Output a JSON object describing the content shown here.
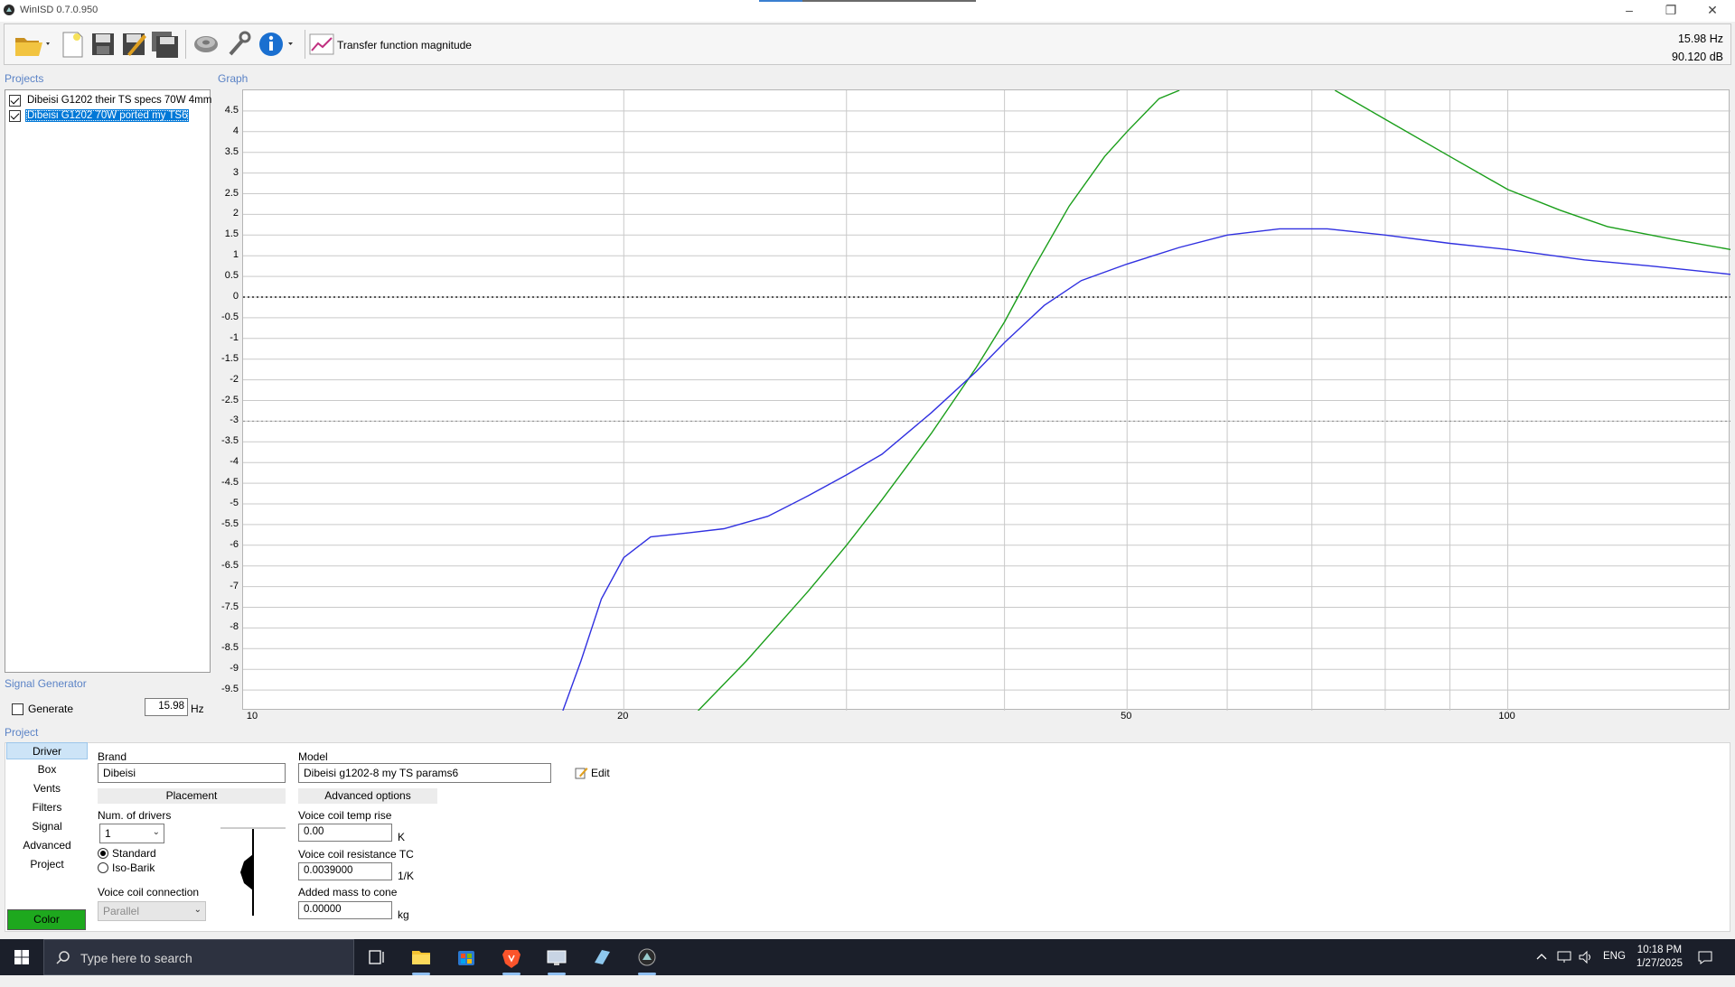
{
  "window": {
    "title": "WinISD 0.7.0.950"
  },
  "toolbar": {
    "mode_label": "Transfer function magnitude",
    "readout_freq": "15.98 Hz",
    "readout_db": "90.120 dB"
  },
  "sections": {
    "projects": "Projects",
    "graph": "Graph",
    "signal_generator": "Signal Generator",
    "project": "Project"
  },
  "projects": [
    {
      "label": "Dibeisi G1202 their TS specs 70W 4mm",
      "checked": true,
      "selected": false
    },
    {
      "label": "Dibeisi G1202 70W ported my TS6",
      "checked": true,
      "selected": true
    }
  ],
  "signal_generator": {
    "generate_label": "Generate",
    "frequency": "15.98",
    "unit": "Hz"
  },
  "nav": [
    "Driver",
    "Box",
    "Vents",
    "Filters",
    "Signal",
    "Advanced",
    "Project"
  ],
  "color_button": "Color",
  "driver": {
    "brand_label": "Brand",
    "brand_value": "Dibeisi",
    "model_label": "Model",
    "model_value": "Dibeisi g1202-8 my TS params6",
    "edit_label": "Edit",
    "placement_header": "Placement",
    "advanced_header": "Advanced options",
    "num_drivers_label": "Num. of drivers",
    "num_drivers_value": "1",
    "standard_label": "Standard",
    "isobarik_label": "Iso-Barik",
    "vc_connection_label": "Voice coil connection",
    "vc_connection_value": "Parallel",
    "vc_temp_label": "Voice coil temp rise",
    "vc_temp_value": "0.00",
    "vc_temp_unit": "K",
    "vc_res_label": "Voice coil resistance TC",
    "vc_res_value": "0.0039000",
    "vc_res_unit": "1/K",
    "mass_label": "Added mass to cone",
    "mass_value": "0.00000",
    "mass_unit": "kg"
  },
  "taskbar": {
    "search_placeholder": "Type here to search",
    "lang": "ENG",
    "time": "10:18 PM",
    "date": "1/27/2025"
  },
  "chart_data": {
    "type": "line",
    "title": "",
    "xlabel": "",
    "ylabel": "",
    "x_scale": "log",
    "xlim": [
      10,
      150
    ],
    "ylim": [
      -10,
      5
    ],
    "x_ticks": [
      "10",
      "20",
      "50",
      "100"
    ],
    "y_ticks": [
      "4.5",
      "4",
      "3.5",
      "3",
      "2.5",
      "2",
      "1.5",
      "1",
      "0.5",
      "0",
      "-0.5",
      "-1",
      "-1.5",
      "-2",
      "-2.5",
      "-3",
      "-3.5",
      "-4",
      "-4.5",
      "-5",
      "-5.5",
      "-6",
      "-6.5",
      "-7",
      "-7.5",
      "-8",
      "-8.5",
      "-9",
      "-9.5"
    ],
    "reference_lines": [
      0,
      -3
    ],
    "grid": true,
    "series": [
      {
        "color": "#1a9e1a",
        "points": [
          [
            22.9,
            -10
          ],
          [
            25,
            -8.8
          ],
          [
            28,
            -7.1
          ],
          [
            30,
            -6.0
          ],
          [
            32,
            -4.9
          ],
          [
            35,
            -3.3
          ],
          [
            38,
            -1.7
          ],
          [
            40,
            -0.6
          ],
          [
            42,
            0.6
          ],
          [
            45,
            2.2
          ],
          [
            48,
            3.4
          ],
          [
            50,
            4.0
          ],
          [
            53,
            4.8
          ],
          [
            55,
            5.0
          ]
        ],
        "points_right": [
          [
            73,
            5.0
          ],
          [
            80,
            4.3
          ],
          [
            90,
            3.4
          ],
          [
            100,
            2.6
          ],
          [
            110,
            2.1
          ],
          [
            120,
            1.7
          ],
          [
            135,
            1.4
          ],
          [
            150,
            1.15
          ]
        ]
      },
      {
        "color": "#3030e0",
        "points": [
          [
            17.9,
            -10
          ],
          [
            18.5,
            -8.8
          ],
          [
            19.2,
            -7.3
          ],
          [
            20,
            -6.3
          ],
          [
            21,
            -5.8
          ],
          [
            22.5,
            -5.7
          ],
          [
            24,
            -5.6
          ],
          [
            26,
            -5.3
          ],
          [
            28,
            -4.8
          ],
          [
            30,
            -4.3
          ],
          [
            32,
            -3.8
          ],
          [
            35,
            -2.8
          ],
          [
            38,
            -1.8
          ],
          [
            40,
            -1.1
          ],
          [
            43,
            -0.2
          ],
          [
            46,
            0.4
          ],
          [
            50,
            0.8
          ],
          [
            55,
            1.2
          ],
          [
            60,
            1.5
          ],
          [
            66,
            1.65
          ],
          [
            72,
            1.65
          ],
          [
            80,
            1.5
          ],
          [
            90,
            1.3
          ],
          [
            100,
            1.15
          ],
          [
            115,
            0.9
          ],
          [
            130,
            0.75
          ],
          [
            150,
            0.55
          ]
        ]
      }
    ]
  }
}
